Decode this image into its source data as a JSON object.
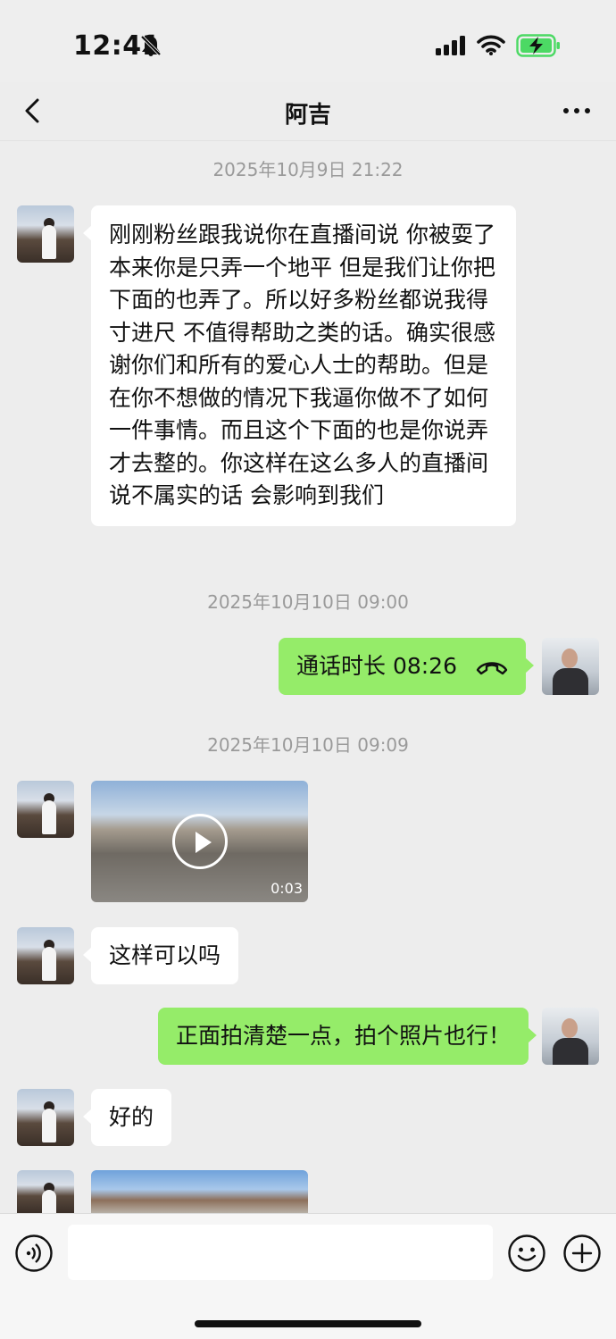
{
  "status_bar": {
    "time": "12:41"
  },
  "nav": {
    "title": "阿吉"
  },
  "timestamps": {
    "t1": "2025年10月9日 21:22",
    "t2": "2025年10月10日 09:00",
    "t3": "2025年10月10日 09:09"
  },
  "messages": {
    "m1": "刚刚粉丝跟我说你在直播间说 你被耍了 本来你是只弄一个地平 但是我们让你把下面的也弄了。所以好多粉丝都说我得寸进尺 不值得帮助之类的话。确实很感谢你们和所有的爱心人士的帮助。但是在你不想做的情况下我逼你做不了如何一件事情。而且这个下面的也是你说弄才去整的。你这样在这么多人的直播间说不属实的话 会影响到我们",
    "call_label": "通话时长 08:26",
    "video_duration": "0:03",
    "m3": "这样可以吗",
    "m4": "正面拍清楚一点，拍个照片也行！",
    "m5": "好的"
  },
  "input": {
    "value": ""
  },
  "colors": {
    "background": "#ededed",
    "sent_bubble": "#95ec69",
    "received_bubble": "#ffffff",
    "timestamp_text": "#9a9a9a",
    "battery": "#4cd964"
  },
  "icons": [
    "bell-slash-icon",
    "signal-icon",
    "wifi-icon",
    "battery-charging-icon",
    "back-icon",
    "more-icon",
    "phone-hangup-icon",
    "play-icon",
    "voice-icon",
    "emoji-icon",
    "plus-icon"
  ]
}
